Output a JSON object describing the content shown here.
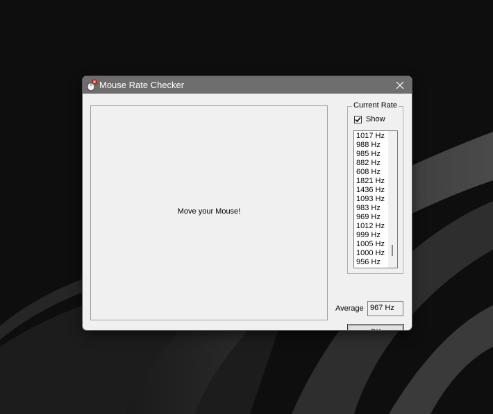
{
  "window": {
    "title": "Mouse Rate Checker",
    "icon": "mouse-app-icon",
    "close_icon": "close-icon"
  },
  "mouse_area": {
    "prompt": "Move your Mouse!"
  },
  "current_rate": {
    "group_label": "Current Rate",
    "show_label": "Show",
    "show_checked": true,
    "rates": [
      "1017 Hz",
      "988 Hz",
      "985 Hz",
      "882 Hz",
      "608 Hz",
      "1821 Hz",
      "1436 Hz",
      "1093 Hz",
      "983 Hz",
      "969 Hz",
      "1012 Hz",
      "999 Hz",
      "1005 Hz",
      "1000 Hz",
      "956 Hz"
    ]
  },
  "average": {
    "label": "Average",
    "value": "967 Hz"
  },
  "ok_button": {
    "label": "OK"
  },
  "colors": {
    "titlebar": "#6e6e6e",
    "window_bg": "#f0f0f0",
    "desktop_bg": "#0e0e0e"
  }
}
